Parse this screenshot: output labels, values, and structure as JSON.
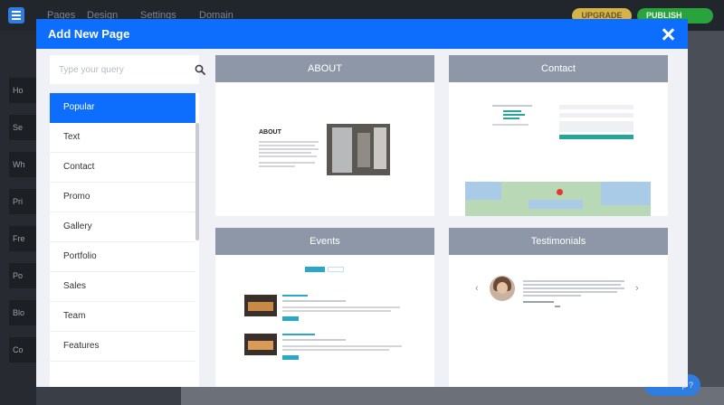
{
  "editor": {
    "nav": [
      "Pages",
      "Design",
      "Settings",
      "Domain"
    ],
    "upgrade_label": "UPGRADE",
    "publish_label": "PUBLISH",
    "rail_items": [
      "Ho",
      "Se",
      "Wh",
      "Pri",
      "Fre",
      "Po",
      "Blo",
      "Co"
    ],
    "help_label": "p ?"
  },
  "modal": {
    "title": "Add New Page",
    "search_placeholder": "Type your query",
    "categories": [
      "Popular",
      "Text",
      "Contact",
      "Promo",
      "Gallery",
      "Portfolio",
      "Sales",
      "Team",
      "Features"
    ],
    "active_category": "Popular",
    "cards": [
      {
        "title": "ABOUT",
        "preview_heading": "ABOUT"
      },
      {
        "title": "Contact"
      },
      {
        "title": "Events"
      },
      {
        "title": "Testimonials"
      }
    ]
  },
  "colors": {
    "modal_header": "#0d6efd",
    "active_category": "#0d6efd",
    "card_header": "#8d97a7",
    "publish": "#29a33b",
    "upgrade": "#d6b24a"
  },
  "icons": [
    "menu-icon",
    "search-icon",
    "close-icon",
    "chevron-left-icon",
    "chevron-right-icon"
  ]
}
